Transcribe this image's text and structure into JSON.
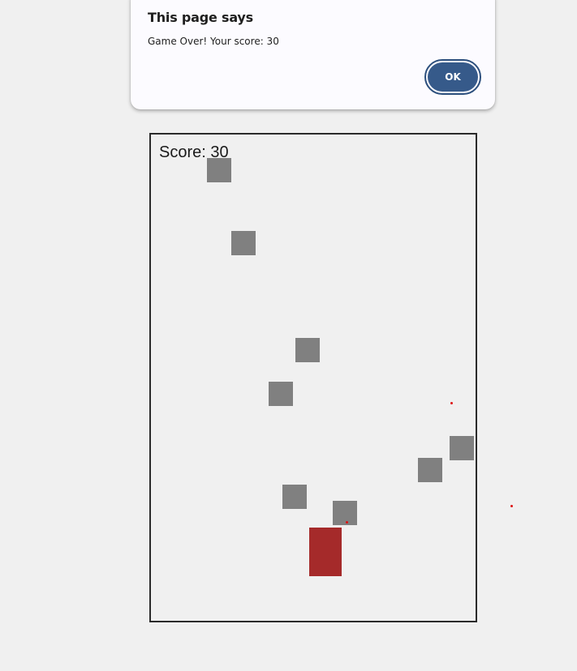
{
  "dialog": {
    "title": "This page says",
    "message": "Game Over! Your score: 30",
    "ok_label": "OK"
  },
  "game": {
    "score_text": "Score: 30",
    "colors": {
      "obstacle": "#808080",
      "player": "#a52a2a",
      "bullet": "#dd1111",
      "border": "#2b2b2b"
    }
  }
}
